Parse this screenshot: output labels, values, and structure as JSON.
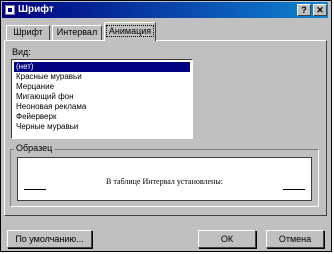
{
  "window": {
    "title": "Шрифт",
    "help_button": "?",
    "close_button": "✕"
  },
  "tabs": [
    {
      "label": "Шрифт",
      "active": false
    },
    {
      "label": "Интервал",
      "active": false
    },
    {
      "label": "Анимация",
      "active": true
    }
  ],
  "animation": {
    "label": "Вид:",
    "items": [
      "(нет)",
      "Красные муравьи",
      "Мерцание",
      "Мигающий фон",
      "Неоновая реклама",
      "Фейерверк",
      "Черные муравьи"
    ],
    "selected_index": 0
  },
  "preview": {
    "label": "Образец",
    "text": "В таблице Интервал установлены:"
  },
  "buttons": {
    "default": "По умолчанию...",
    "ok": "ОК",
    "cancel": "Отмена"
  },
  "colors": {
    "title_bar": "#000080",
    "selection": "#000080",
    "face": "#c0c0c0"
  }
}
